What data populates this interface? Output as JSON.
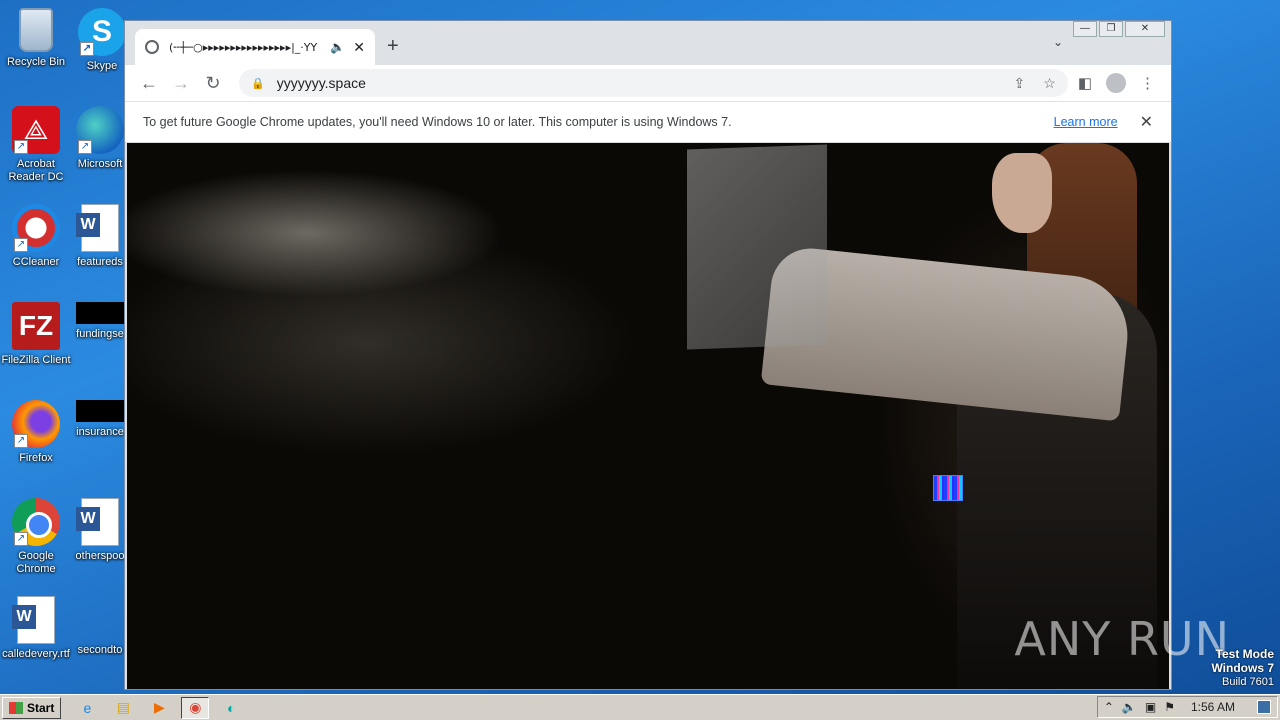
{
  "desktop": {
    "icons": [
      {
        "label": "Recycle Bin",
        "icon": "recycle-bin-icon"
      },
      {
        "label": "Skype",
        "icon": "skype-icon"
      },
      {
        "label": "Acrobat Reader DC",
        "icon": "acrobat-icon"
      },
      {
        "label": "Microsoft",
        "icon": "edge-icon"
      },
      {
        "label": "CCleaner",
        "icon": "ccleaner-icon"
      },
      {
        "label": "featureds",
        "icon": "word-doc-icon"
      },
      {
        "label": "FileZilla Client",
        "icon": "filezilla-icon"
      },
      {
        "label": "fundingse",
        "icon": "black-file-icon"
      },
      {
        "label": "Firefox",
        "icon": "firefox-icon"
      },
      {
        "label": "insurance",
        "icon": "black-file-icon"
      },
      {
        "label": "Google Chrome",
        "icon": "chrome-icon"
      },
      {
        "label": "otherspoo",
        "icon": "word-doc-icon"
      },
      {
        "label": "calledevery.rtf",
        "icon": "word-doc-icon"
      },
      {
        "label": "secondto",
        "icon": "blank-file-icon"
      }
    ],
    "watermark": "ANY RUN",
    "test_mode": {
      "line1": "Test Mode",
      "line2": "Windows 7",
      "line3": "Build 7601"
    }
  },
  "browser": {
    "tab": {
      "title": "(╌┼─○▸▸▸▸▸▸▸▸▸▸▸▸▸▸▸▸|_·YY",
      "speaker": "🔈",
      "close": "✕"
    },
    "new_tab": "+",
    "tab_menu": "⌄",
    "window_controls": {
      "minimize": "—",
      "restore": "❐",
      "close": "✕"
    },
    "toolbar": {
      "back": "←",
      "forward": "→",
      "reload": "↻",
      "url": "yyyyyyy.space"
    },
    "infobar": {
      "message": "To get future Google Chrome updates, you'll need Windows 10 or later. This computer is using Windows 7.",
      "link": "Learn more",
      "close": "✕"
    }
  },
  "taskbar": {
    "start_label": "Start",
    "apps": [
      "ie-icon",
      "explorer-icon",
      "media-player-icon",
      "chrome-icon",
      "edge-icon"
    ],
    "clock": "1:56 AM"
  }
}
